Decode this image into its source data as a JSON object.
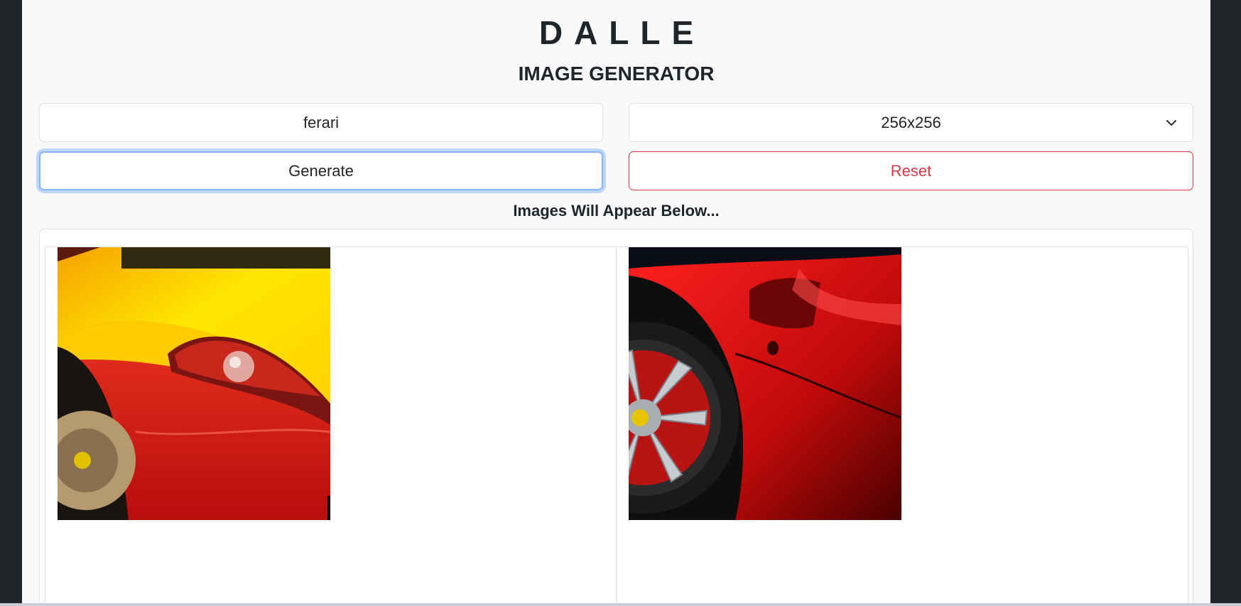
{
  "header": {
    "title": "DALLE",
    "subtitle": "IMAGE GENERATOR"
  },
  "form": {
    "prompt_value": "ferari",
    "size_selected": "256x256",
    "generate_label": "Generate",
    "reset_label": "Reset"
  },
  "results": {
    "heading": "Images Will Appear Below...",
    "images": [
      {
        "subject": "yellow and red sports car front fender with headlight"
      },
      {
        "subject": "red sports car side with silver five-spoke wheel"
      }
    ]
  },
  "colors": {
    "page_bg": "#f8f9fa",
    "outer_bg": "#212529",
    "text": "#212529",
    "focus_border": "#86b7fe",
    "danger": "#dc3545",
    "border": "#dee2e6"
  }
}
